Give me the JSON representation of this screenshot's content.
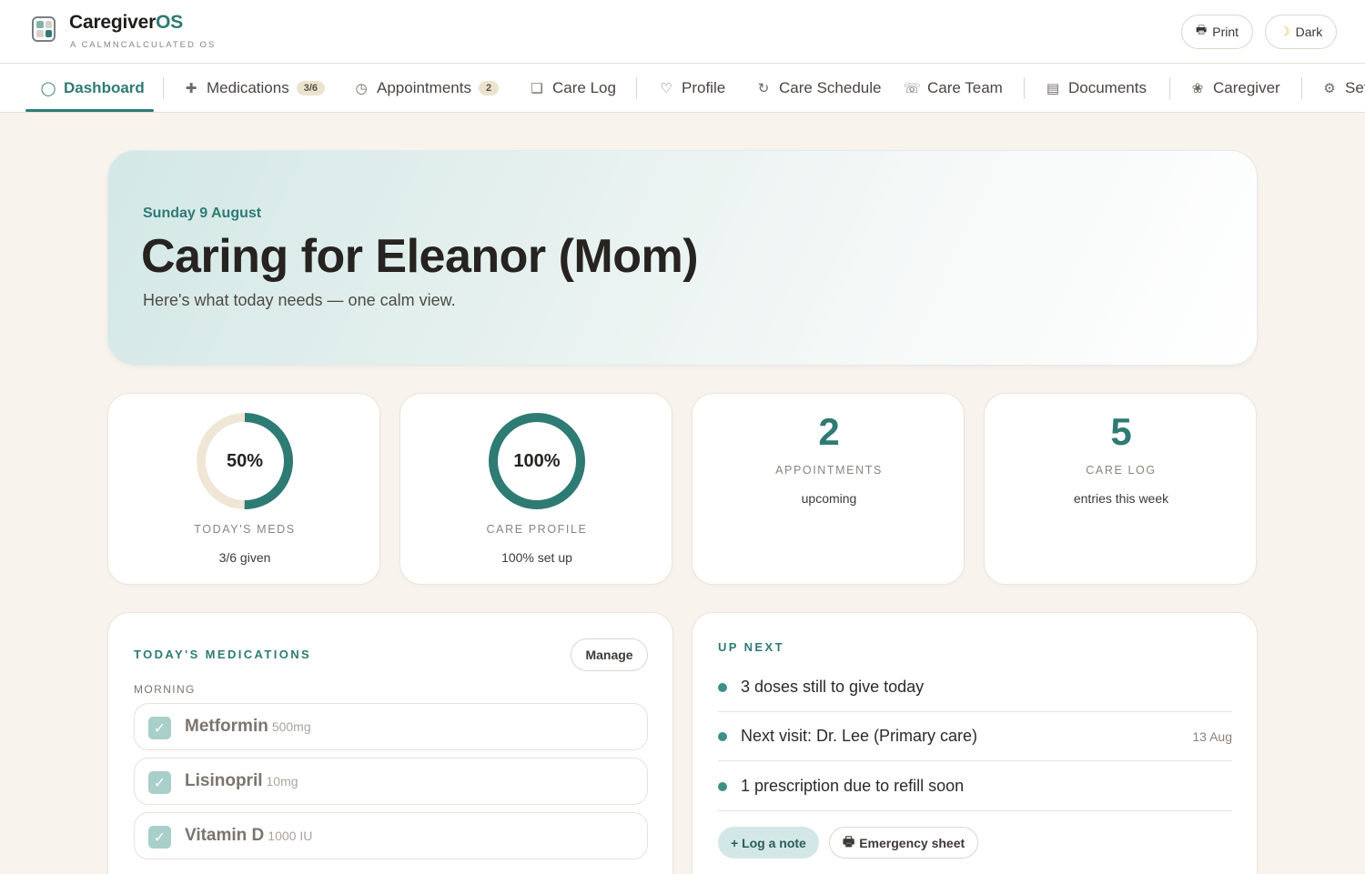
{
  "app": {
    "name_main": "Caregiver",
    "name_accent": "OS",
    "tagline": "A CALMNCALCULATED OS"
  },
  "header": {
    "print_label": "Print",
    "dark_label": "Dark"
  },
  "nav": {
    "items": [
      {
        "label": "Dashboard",
        "icon": "ring-icon"
      },
      {
        "label": "Medications",
        "icon": "plus-icon",
        "badge": "3/6"
      },
      {
        "label": "Appointments",
        "icon": "clock-icon",
        "badge": "2"
      },
      {
        "label": "Care Log",
        "icon": "notebook-icon"
      },
      {
        "label": "Profile",
        "icon": "heart-icon"
      },
      {
        "label": "Care Schedule",
        "icon": "refresh-icon"
      },
      {
        "label": "Care Team",
        "icon": "phone-icon"
      },
      {
        "label": "Documents",
        "icon": "document-icon"
      },
      {
        "label": "Caregiver",
        "icon": "flower-icon"
      },
      {
        "label": "Set",
        "icon": "gear-icon"
      }
    ]
  },
  "hero": {
    "date": "Sunday 9 August",
    "title": "Caring for Eleanor (Mom)",
    "subtitle": "Here's what today needs — one calm view."
  },
  "stats": {
    "meds": {
      "value": "50%",
      "fraction": 0.5,
      "caption": "TODAY'S MEDS",
      "note": "3/6 given"
    },
    "profile": {
      "value": "100%",
      "fraction": 1.0,
      "caption": "CARE PROFILE",
      "note": "100% set up"
    },
    "appointments": {
      "value": "2",
      "caption": "APPOINTMENTS",
      "note": "upcoming"
    },
    "carelog": {
      "value": "5",
      "caption": "CARE LOG",
      "note": "entries this week"
    }
  },
  "medications": {
    "title": "TODAY'S MEDICATIONS",
    "manage_label": "Manage",
    "group": "MORNING",
    "items": [
      {
        "name": "Metformin",
        "dose": "500mg",
        "checked": true
      },
      {
        "name": "Lisinopril",
        "dose": "10mg",
        "checked": true
      },
      {
        "name": "Vitamin D",
        "dose": "1000 IU",
        "checked": true
      }
    ]
  },
  "upnext": {
    "title": "UP NEXT",
    "items": [
      {
        "text": "3 doses still to give today",
        "date": ""
      },
      {
        "text": "Next visit: Dr. Lee (Primary care)",
        "date": "13 Aug"
      },
      {
        "text": "1 prescription due to refill soon",
        "date": ""
      }
    ],
    "log_note_label": "+ Log a note",
    "emergency_label": "Emergency sheet"
  },
  "colors": {
    "accent": "#2e7b74",
    "ring_track": "#efe6d6",
    "background": "#f8f3ed"
  }
}
